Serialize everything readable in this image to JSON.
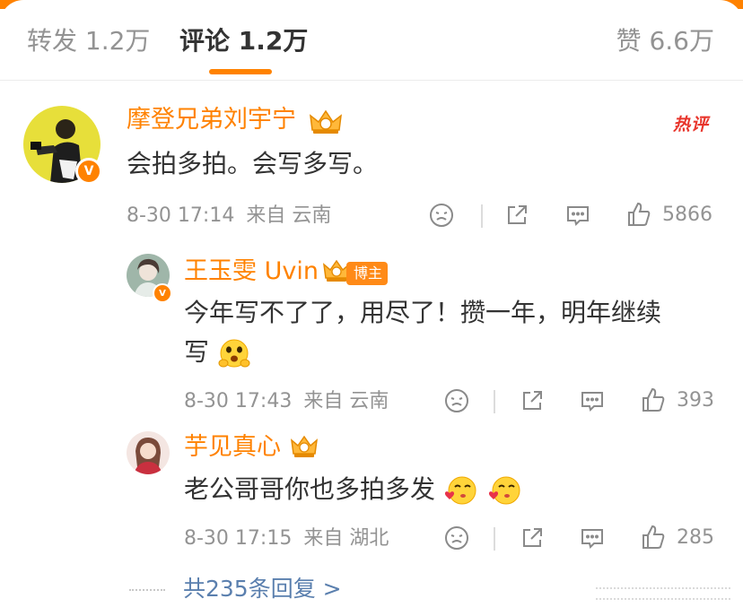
{
  "tabs": {
    "repost": "转发 1.2万",
    "comments": "评论 1.2万",
    "likes": "赞 6.6万"
  },
  "colors": {
    "accent": "#ff8200",
    "username": "#ff8200",
    "link": "#5a7fae",
    "hot": "#e8352c"
  },
  "comments": [
    {
      "user": "摩登兄弟刘宇宁",
      "badge": "热评",
      "text": "会拍多拍。会写多写。",
      "time": "8-30 17:14",
      "source": "来自 云南",
      "likes": "5866"
    }
  ],
  "replies": [
    {
      "user": "王玉雯 Uvin",
      "tag": "博主",
      "text_line1": "今年写不了了，用尽了！攒一年，明年继续",
      "text_line2": "写",
      "emoji": "hug-face",
      "time": "8-30 17:43",
      "source": "来自 云南",
      "likes": "393"
    },
    {
      "user": "芋见真心",
      "text": "老公哥哥你也多拍多发",
      "emoji": "kiss-face",
      "time": "8-30 17:15",
      "source": "来自 湖北",
      "likes": "285"
    }
  ],
  "more_replies": "共235条回复 >",
  "icons": [
    "crown-icon",
    "dislike-icon",
    "share-icon",
    "comment-icon",
    "like-icon",
    "verified-icon"
  ]
}
